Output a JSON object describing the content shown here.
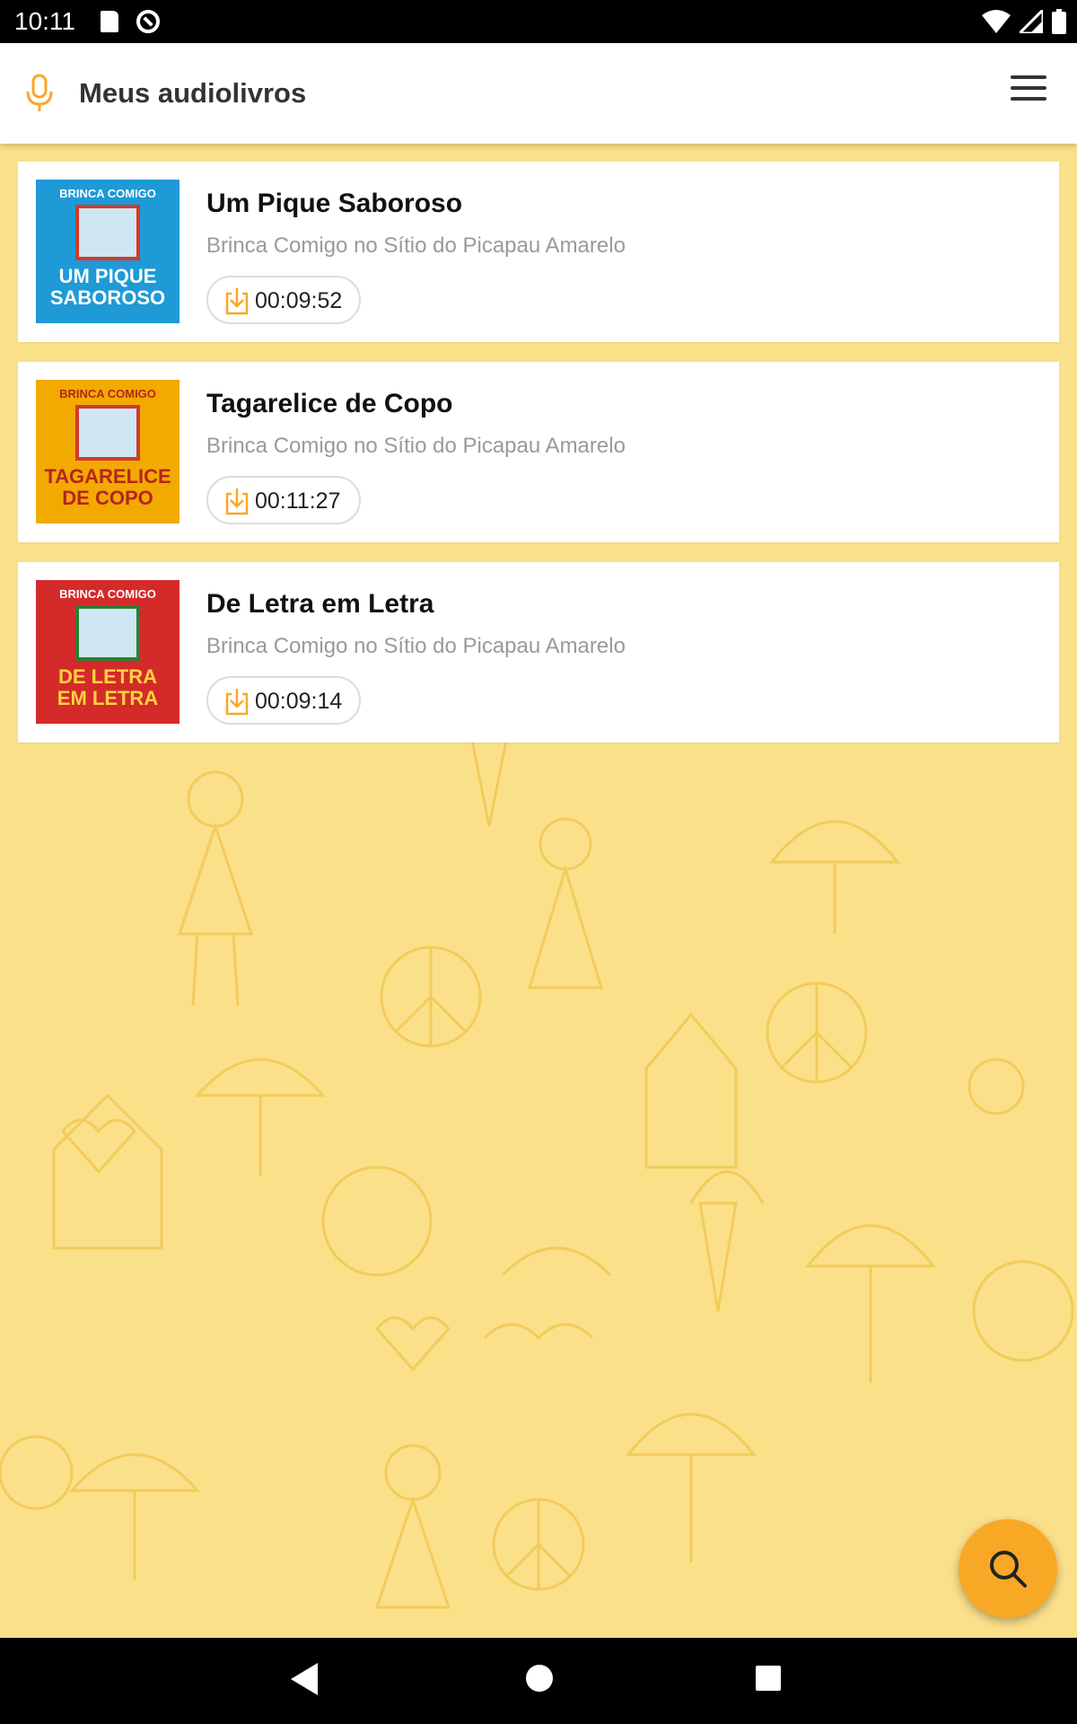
{
  "status_bar": {
    "time": "10:11"
  },
  "app_bar": {
    "title": "Meus audiolivros",
    "accent_color": "#f9a825"
  },
  "books": [
    {
      "title": "Um Pique Saboroso",
      "subtitle": "Brinca Comigo no Sítio do Picapau Amarelo",
      "duration": "00:09:52",
      "cover": {
        "series": "BRINCA COMIGO",
        "title_line1": "UM PIQUE",
        "title_line2": "SABOROSO",
        "bg": "#1e9ad6",
        "text_color": "#ffffff"
      }
    },
    {
      "title": "Tagarelice de Copo",
      "subtitle": "Brinca Comigo no Sítio do Picapau Amarelo",
      "duration": "00:11:27",
      "cover": {
        "series": "BRINCA COMIGO",
        "title_line1": "TAGARELICE",
        "title_line2": "DE COPO",
        "bg": "#f2a900",
        "text_color": "#b3261e"
      }
    },
    {
      "title": "De Letra em Letra",
      "subtitle": "Brinca Comigo no Sítio do Picapau Amarelo",
      "duration": "00:09:14",
      "cover": {
        "series": "BRINCA COMIGO",
        "title_line1": "DE LETRA",
        "title_line2": "EM LETRA",
        "bg": "#d42a2a",
        "text_color": "#ffd23f"
      }
    }
  ],
  "icons": {
    "app": "microphone-icon",
    "menu": "hamburger-menu-icon",
    "download": "download-icon",
    "fab": "search-icon"
  }
}
